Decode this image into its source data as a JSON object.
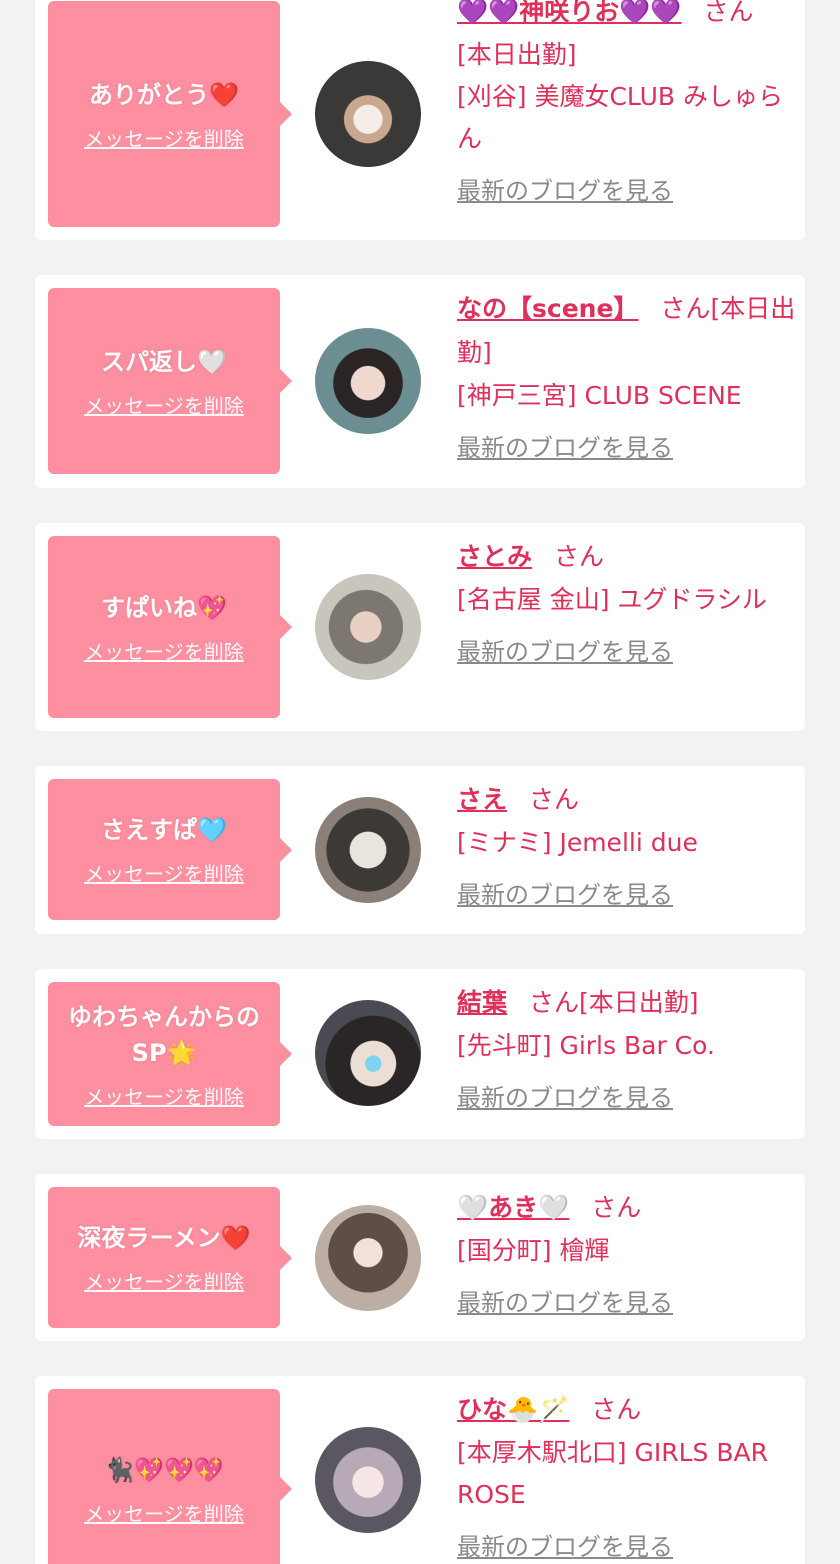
{
  "colors": {
    "page_bg": "#f2f2f2",
    "card_bg": "#ffffff",
    "bubble_bg": "#fe8fa0",
    "accent_text": "#e0305a",
    "muted_link": "#8a8a8a"
  },
  "messages": [
    {
      "message": "ありがとう❤️",
      "delete_label": "メッセージを削除",
      "name": "💜💜神咲りお💜💜",
      "honorific": "さん",
      "status": "",
      "details": [
        "[本日出勤]",
        "[刈谷] 美魔女CLUB みしゅらん"
      ],
      "blog_label": "最新のブログを見る",
      "avatar_icon": "profile-photo"
    },
    {
      "message": "スパ返し🤍",
      "delete_label": "メッセージを削除",
      "name": "なの【scene】",
      "honorific": "さん",
      "status": "[本日出勤]",
      "details": [
        "[神戸三宮] CLUB SCENE"
      ],
      "blog_label": "最新のブログを見る",
      "avatar_icon": "profile-photo"
    },
    {
      "message": "すぱいね💖",
      "delete_label": "メッセージを削除",
      "name": "さとみ",
      "honorific": "さん",
      "status": "",
      "details": [
        "[名古屋 金山] ユグドラシル"
      ],
      "blog_label": "最新のブログを見る",
      "avatar_icon": "profile-photo"
    },
    {
      "message": "さえすぱ🩵",
      "delete_label": "メッセージを削除",
      "name": "さえ",
      "honorific": "さん",
      "status": "",
      "details": [
        "[ミナミ] Jemelli due"
      ],
      "blog_label": "最新のブログを見る",
      "avatar_icon": "profile-photo"
    },
    {
      "message": "ゆわちゃんからのSP🌟",
      "delete_label": "メッセージを削除",
      "name": "結葉",
      "honorific": "さん",
      "status": "[本日出勤]",
      "details": [
        "[先斗町] Girls Bar Co."
      ],
      "blog_label": "最新のブログを見る",
      "avatar_icon": "profile-photo"
    },
    {
      "message": "深夜ラーメン❤️",
      "delete_label": "メッセージを削除",
      "name": "🤍あき🤍",
      "honorific": "さん",
      "status": "",
      "details": [
        "[国分町] 檜輝"
      ],
      "blog_label": "最新のブログを見る",
      "avatar_icon": "profile-photo"
    },
    {
      "message": "🐈‍⬛💖💖💖",
      "delete_label": "メッセージを削除",
      "name": "ひな🐣🪄",
      "honorific": "さん",
      "status": "",
      "details": [
        "[本厚木駅北口] GIRLS BAR ROSE"
      ],
      "blog_label": "最新のブログを見る",
      "avatar_icon": "profile-photo"
    }
  ]
}
